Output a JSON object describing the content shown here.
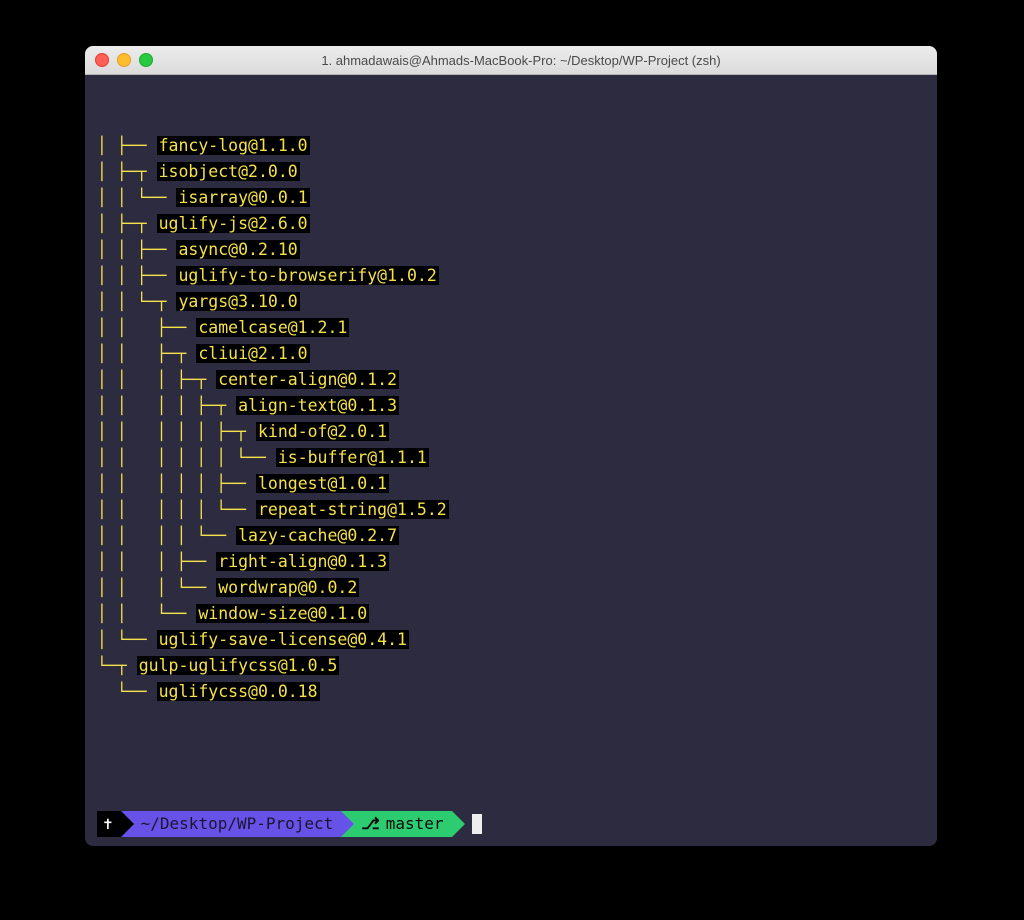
{
  "window": {
    "title": "1. ahmadawais@Ahmads-MacBook-Pro: ~/Desktop/WP-Project (zsh)"
  },
  "tree_lines": [
    {
      "prefix": "│ ├── ",
      "pkg": "fancy-log@1.1.0"
    },
    {
      "prefix": "│ ├─┬ ",
      "pkg": "isobject@2.0.0"
    },
    {
      "prefix": "│ │ └── ",
      "pkg": "isarray@0.0.1"
    },
    {
      "prefix": "│ ├─┬ ",
      "pkg": "uglify-js@2.6.0"
    },
    {
      "prefix": "│ │ ├── ",
      "pkg": "async@0.2.10"
    },
    {
      "prefix": "│ │ ├── ",
      "pkg": "uglify-to-browserify@1.0.2"
    },
    {
      "prefix": "│ │ └─┬ ",
      "pkg": "yargs@3.10.0"
    },
    {
      "prefix": "│ │   ├── ",
      "pkg": "camelcase@1.2.1"
    },
    {
      "prefix": "│ │   ├─┬ ",
      "pkg": "cliui@2.1.0"
    },
    {
      "prefix": "│ │   │ ├─┬ ",
      "pkg": "center-align@0.1.2"
    },
    {
      "prefix": "│ │   │ │ ├─┬ ",
      "pkg": "align-text@0.1.3"
    },
    {
      "prefix": "│ │   │ │ │ ├─┬ ",
      "pkg": "kind-of@2.0.1"
    },
    {
      "prefix": "│ │   │ │ │ │ └── ",
      "pkg": "is-buffer@1.1.1"
    },
    {
      "prefix": "│ │   │ │ │ ├── ",
      "pkg": "longest@1.0.1"
    },
    {
      "prefix": "│ │   │ │ │ └── ",
      "pkg": "repeat-string@1.5.2"
    },
    {
      "prefix": "│ │   │ │ └── ",
      "pkg": "lazy-cache@0.2.7"
    },
    {
      "prefix": "│ │   │ ├── ",
      "pkg": "right-align@0.1.3"
    },
    {
      "prefix": "│ │   │ └── ",
      "pkg": "wordwrap@0.0.2"
    },
    {
      "prefix": "│ │   └── ",
      "pkg": "window-size@0.1.0"
    },
    {
      "prefix": "│ └── ",
      "pkg": "uglify-save-license@0.4.1"
    },
    {
      "prefix": "└─┬ ",
      "pkg": "gulp-uglifycss@1.0.5"
    },
    {
      "prefix": "  └── ",
      "pkg": "uglifycss@0.0.18"
    }
  ],
  "prompt": {
    "cross": "✝",
    "path": "~/Desktop/WP-Project",
    "branch": "master"
  }
}
